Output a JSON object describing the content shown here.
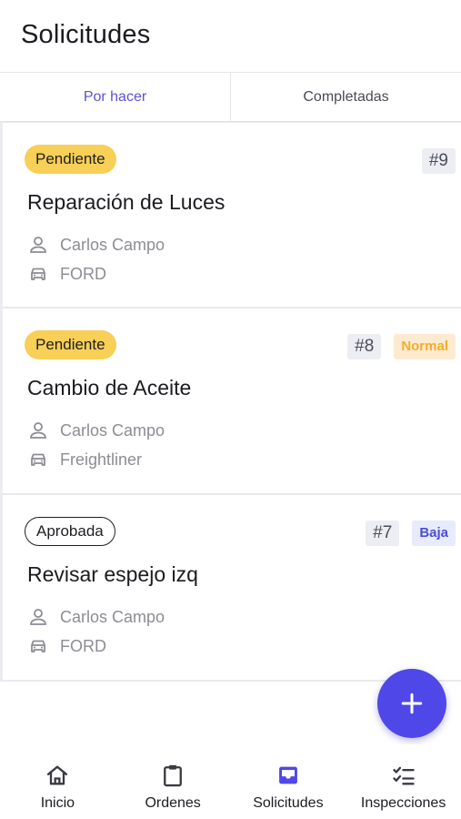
{
  "header": {
    "title": "Solicitudes"
  },
  "tabs": [
    {
      "label": "Por hacer",
      "active": true
    },
    {
      "label": "Completadas",
      "active": false
    }
  ],
  "cards": [
    {
      "status": "Pendiente",
      "number": "#9",
      "priority": "",
      "title": "Reparación de Luces",
      "person": "Carlos Campo",
      "vehicle": "FORD"
    },
    {
      "status": "Pendiente",
      "number": "#8",
      "priority": "Normal",
      "title": "Cambio de Aceite",
      "person": "Carlos Campo",
      "vehicle": "Freightliner"
    },
    {
      "status": "Aprobada",
      "number": "#7",
      "priority": "Baja",
      "title": "Revisar espejo izq",
      "person": "Carlos Campo",
      "vehicle": "FORD"
    }
  ],
  "fab": {
    "icon": "plus-icon"
  },
  "nav": [
    {
      "label": "Inicio",
      "icon": "home-icon"
    },
    {
      "label": "Ordenes",
      "icon": "clipboard-icon"
    },
    {
      "label": "Solicitudes",
      "icon": "inbox-icon"
    },
    {
      "label": "Inspecciones",
      "icon": "checklist-icon"
    }
  ],
  "colors": {
    "accent": "#5047e8",
    "pending": "#f8cf57",
    "priority_normal": "#f1ad2c",
    "priority_baja": "#4b4ed1"
  }
}
